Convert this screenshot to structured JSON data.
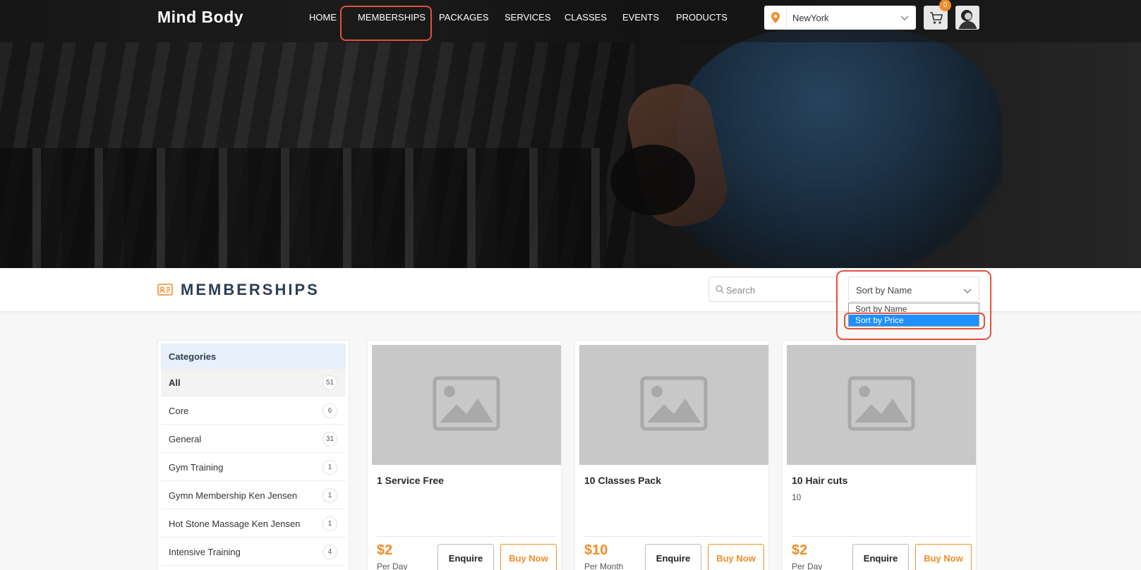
{
  "brand": {
    "logo": "Mind Body"
  },
  "nav": {
    "items": [
      "HOME",
      "MEMBERSHIPS",
      "PACKAGES",
      "SERVICES",
      "CLASSES",
      "EVENTS",
      "PRODUCTS"
    ]
  },
  "location": {
    "value": "NewYork",
    "icon": "map-pin-icon"
  },
  "cart": {
    "count": "0",
    "icon": "cart-icon"
  },
  "page": {
    "title": "MEMBERSHIPS",
    "title_icon": "id-card-icon"
  },
  "search": {
    "placeholder": "Search",
    "value": ""
  },
  "sort": {
    "selected": "Sort by Name",
    "options": [
      "Sort by Name",
      "Sort by Price"
    ],
    "highlighted_option": "Sort by Price"
  },
  "sidebar": {
    "heading": "Categories",
    "items": [
      {
        "label": "All",
        "count": "51"
      },
      {
        "label": "Core",
        "count": "6"
      },
      {
        "label": "General",
        "count": "31"
      },
      {
        "label": "Gym Training",
        "count": "1"
      },
      {
        "label": "Gymn Membership Ken Jensen",
        "count": "1"
      },
      {
        "label": "Hot Stone Massage Ken Jensen",
        "count": "1"
      },
      {
        "label": "Intensive Training",
        "count": "4"
      }
    ]
  },
  "cards": [
    {
      "name": "1 Service Free",
      "subtitle": "",
      "price": "$2",
      "period": "Per Day",
      "enquire_label": "Enquire",
      "buy_label": "Buy Now"
    },
    {
      "name": "10 Classes Pack",
      "subtitle": "",
      "price": "$10",
      "period": "Per Month",
      "enquire_label": "Enquire",
      "buy_label": "Buy Now"
    },
    {
      "name": "10 Hair cuts",
      "subtitle": "10",
      "price": "$2",
      "period": "Per Day",
      "enquire_label": "Enquire",
      "buy_label": "Buy Now"
    }
  ],
  "colors": {
    "accent": "#f28c28",
    "title": "#2d3e55",
    "highlight": "#e0533b",
    "selected_option": "#1e90ff"
  }
}
